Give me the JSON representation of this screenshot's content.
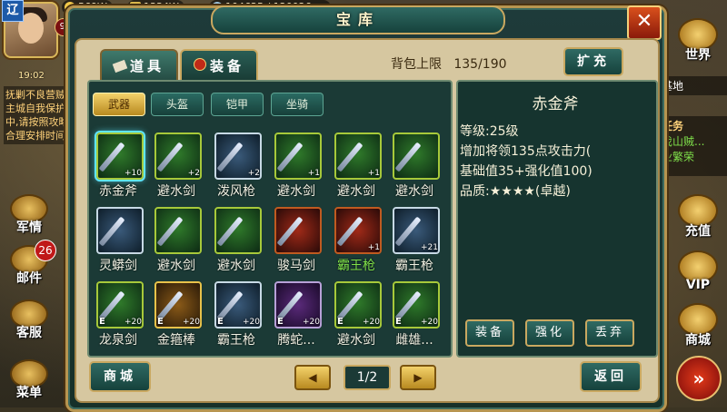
{
  "hud": {
    "player_badge": "辽",
    "level": "99",
    "resources": [
      {
        "label": "569W",
        "color": "#f3c94a"
      },
      {
        "label": "1334W",
        "color": "#d9b64a"
      },
      {
        "label": "104625 / 120026",
        "color": "#9ac0d8"
      }
    ],
    "time": "19:02",
    "left_notice": "抚剿不良营贼,主城自我保护中,请按照攻略合理安排时间",
    "left_buttons": [
      {
        "label": "军情",
        "icon": "military-icon"
      },
      {
        "label": "邮件",
        "icon": "mail-icon",
        "badge": "26"
      },
      {
        "label": "客服",
        "icon": "service-icon"
      },
      {
        "label": "菜单",
        "icon": "menu-icon"
      }
    ],
    "right_buttons": [
      {
        "label": "世界",
        "icon": "world-icon"
      },
      {
        "label": "充值",
        "icon": "recharge-icon"
      },
      {
        "label": "VIP",
        "icon": "vip-icon"
      },
      {
        "label": "商城",
        "icon": "shop-icon"
      }
    ],
    "right_info": {
      "location": "基地",
      "task_title": "任务",
      "task_line1": "伐山贼...",
      "task_line2": "业繁荣"
    }
  },
  "window": {
    "title": "宝库",
    "close_label": "✕",
    "tabs": [
      {
        "label": "道具",
        "icon": "scroll-icon",
        "active": false
      },
      {
        "label": "装备",
        "icon": "helmet-icon",
        "active": true
      }
    ],
    "capacity_label": "背包上限",
    "capacity_value": "135/190",
    "expand_label": "扩充",
    "categories": [
      {
        "label": "武器",
        "active": true
      },
      {
        "label": "头盔",
        "active": false
      },
      {
        "label": "铠甲",
        "active": false
      },
      {
        "label": "坐骑",
        "active": false
      }
    ],
    "items": [
      {
        "name": "赤金斧",
        "plus": "+10",
        "equipped": false,
        "quality": "green",
        "selected": true
      },
      {
        "name": "避水剑",
        "plus": "+2",
        "equipped": false,
        "quality": "green"
      },
      {
        "name": "泼风枪",
        "plus": "+2",
        "equipped": false,
        "quality": "blue"
      },
      {
        "name": "避水剑",
        "plus": "+1",
        "equipped": false,
        "quality": "green"
      },
      {
        "name": "避水剑",
        "plus": "+1",
        "equipped": false,
        "quality": "green"
      },
      {
        "name": "避水剑",
        "plus": "",
        "equipped": false,
        "quality": "green"
      },
      {
        "name": "灵蟒剑",
        "plus": "",
        "equipped": false,
        "quality": "blue"
      },
      {
        "name": "避水剑",
        "plus": "",
        "equipped": false,
        "quality": "green"
      },
      {
        "name": "避水剑",
        "plus": "",
        "equipped": false,
        "quality": "green"
      },
      {
        "name": "骏马剑",
        "plus": "",
        "equipped": false,
        "quality": "red"
      },
      {
        "name": "霸王枪",
        "plus": "+1",
        "equipped": false,
        "quality": "red",
        "green_name": true
      },
      {
        "name": "霸王枪",
        "plus": "+21",
        "equipped": false,
        "quality": "blue"
      },
      {
        "name": "龙泉剑",
        "plus": "+20",
        "equipped": true,
        "quality": "green"
      },
      {
        "name": "金箍棒",
        "plus": "+20",
        "equipped": true,
        "quality": "gold"
      },
      {
        "name": "霸王枪",
        "plus": "+20",
        "equipped": true,
        "quality": "blue"
      },
      {
        "name": "腾蛇...",
        "plus": "+20",
        "equipped": true,
        "quality": "purple"
      },
      {
        "name": "避水剑",
        "plus": "+20",
        "equipped": true,
        "quality": "green"
      },
      {
        "name": "雌雄...",
        "plus": "+20",
        "equipped": true,
        "quality": "green"
      }
    ],
    "equipped_mark": "E",
    "detail": {
      "name": "赤金斧",
      "level": "等级:25级",
      "line1": "增加将领135点攻击力(",
      "line2": "基础值35+强化值100)",
      "quality": "品质:★★★★(卓越)"
    },
    "detail_buttons": [
      "装备",
      "强化",
      "丢弃"
    ],
    "shop_label": "商城",
    "back_label": "返回",
    "prev_label": "◀",
    "next_label": "▶",
    "page": "1/2"
  }
}
